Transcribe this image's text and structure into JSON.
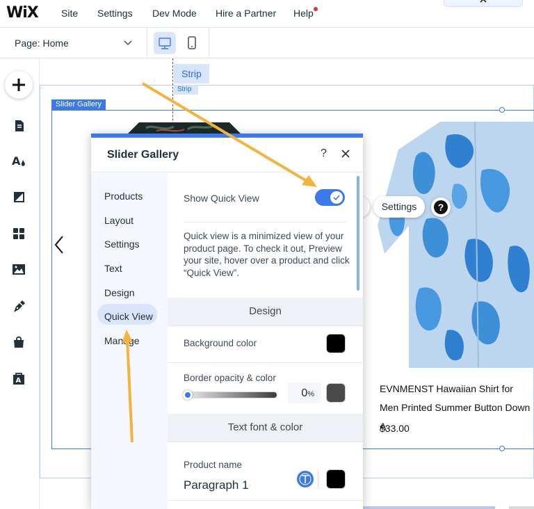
{
  "topbar": {
    "logo": "WiX",
    "menu": [
      "Site",
      "Settings",
      "Dev Mode",
      "Hire a Partner",
      "Help"
    ]
  },
  "pagebar": {
    "page_prefix": "Page:",
    "page_name": "Home"
  },
  "left_toolbar": {
    "icons": [
      "add-icon",
      "pages-icon",
      "design-icon",
      "image-edit-icon",
      "apps-icon",
      "media-icon",
      "pen-icon",
      "store-icon",
      "app-market-icon"
    ]
  },
  "canvas": {
    "strip_label": "Strip",
    "strip_sublabel": "Strip",
    "gallery_label": "Slider Gallery",
    "product": {
      "name": "EVNMENST Hawaiian Shirt for Men Printed Summer Button Down A",
      "price": "$33.00"
    },
    "settings_pill": "Settings",
    "help_pill": "?"
  },
  "panel": {
    "title": "Slider Gallery",
    "help": "?",
    "nav": [
      "Products",
      "Layout",
      "Settings",
      "Text",
      "Design",
      "Quick View",
      "Manage"
    ],
    "active_nav": "Quick View",
    "show_quick_view": {
      "label": "Show Quick View",
      "enabled": true
    },
    "description": "Quick view is a minimized view of your product page. To check it out, Preview your site, hover over a product and click “Quick View”.",
    "design_section": "Design",
    "background_color_label": "Background color",
    "background_color": "#000000",
    "border_label": "Border opacity & color",
    "border_opacity": "0",
    "border_opacity_unit": "%",
    "border_color": "#4a4a4a",
    "text_section": "Text font & color",
    "product_name_label": "Product name",
    "product_name_font": "Paragraph 1",
    "product_name_color": "#000000"
  },
  "colors": {
    "accent": "#3b7ae8",
    "annotation_arrow": "#f4b33e"
  }
}
